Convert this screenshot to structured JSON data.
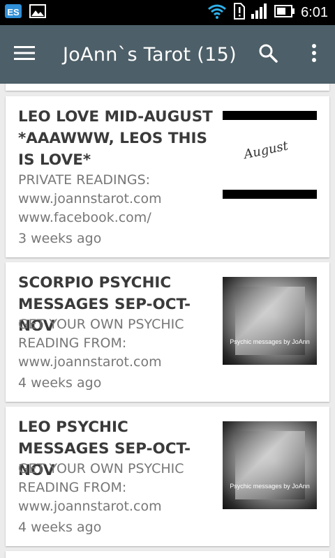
{
  "status_bar": {
    "time": "6:01",
    "icons": [
      "es-file-icon",
      "image-icon",
      "wifi-icon",
      "alert-icon",
      "signal-icon",
      "battery-icon"
    ]
  },
  "app_bar": {
    "title": "JoAnn`s Tarot (15)",
    "background": "#4d5f68"
  },
  "videos": [
    {
      "title": "LEO LOVE MID-AUGUST *AAAWWW, LEOS THIS IS LOVE*",
      "description_lines": [
        "PRIVATE READINGS:",
        "www.joannstarot.com",
        "www.facebook.com/"
      ],
      "time_ago": "3 weeks ago",
      "thumb_text": "August"
    },
    {
      "title": "SCORPIO PSYCHIC MESSAGES SEP-OCT-NOV",
      "description_lines": [
        "GET YOUR OWN PSYCHIC",
        "READING FROM:",
        "www.joannstarot.com"
      ],
      "time_ago": "4 weeks ago",
      "thumb_text": "Psychic messages by JoAnn"
    },
    {
      "title": "LEO PSYCHIC MESSAGES SEP-OCT-NOV",
      "description_lines": [
        "GET YOUR OWN PSYCHIC",
        "READING FROM:",
        "www.joannstarot.com"
      ],
      "time_ago": "4 weeks ago",
      "thumb_text": "Psychic messages by JoAnn"
    }
  ]
}
